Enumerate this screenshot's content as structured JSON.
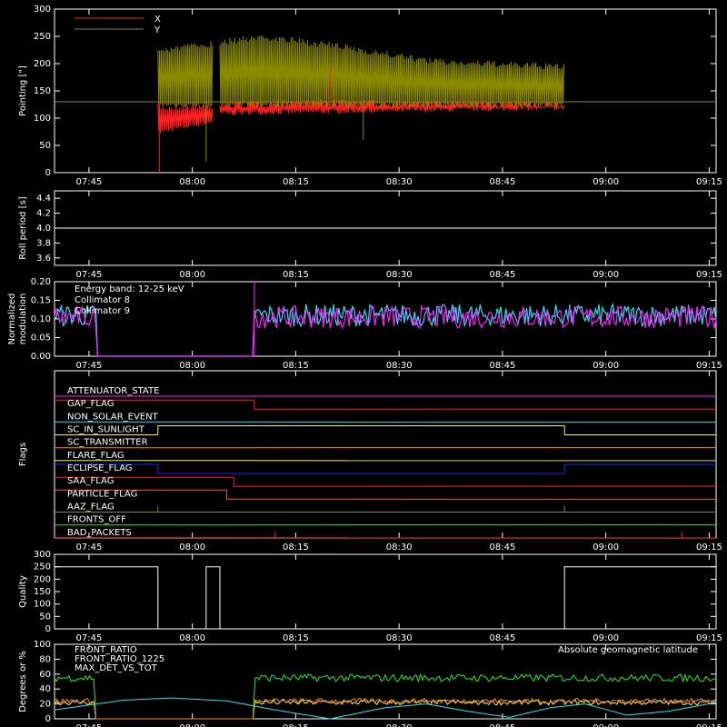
{
  "x_ticks": [
    "07:45",
    "08:00",
    "08:15",
    "08:30",
    "08:45",
    "09:00",
    "09:15"
  ],
  "colors": {
    "axes": "#ffffff",
    "red": "#ff2020",
    "olive": "#8a8a00",
    "cyan": "#22e6ee",
    "magenta": "#ff20ff",
    "green": "#22ee22",
    "orange": "#ff8a1a",
    "yellow": "#f5f54a",
    "blue": "#2222ff",
    "brown": "#c86414",
    "darkorange": "#ff5a00"
  },
  "chart_data": [
    {
      "id": "pointing",
      "type": "line",
      "ylabel": "Pointing [\"]",
      "ylim": [
        0,
        300
      ],
      "yticks": [
        "0",
        "50",
        "100",
        "150",
        "200",
        "250",
        "300"
      ],
      "legend": [
        "X",
        "Y"
      ],
      "baseline": 130,
      "segments": [
        [
          "07:55",
          "08:03"
        ],
        [
          "08:04",
          "08:54"
        ]
      ],
      "series": [
        {
          "name": "X",
          "color": "#ff2020",
          "low": [
            [
              "07:55",
              70
            ],
            [
              "08:03",
              90
            ],
            [
              "08:04",
              105
            ],
            [
              "08:30",
              110
            ],
            [
              "08:54",
              115
            ]
          ],
          "high": [
            [
              "07:55",
              125
            ],
            [
              "08:15",
              135
            ],
            [
              "08:54",
              130
            ]
          ]
        },
        {
          "name": "Y",
          "color": "#8a8a00",
          "low": [
            [
              "07:55",
              120
            ],
            [
              "08:54",
              120
            ]
          ],
          "high": [
            [
              "07:55",
              230
            ],
            [
              "08:04",
              245
            ],
            [
              "08:10",
              255
            ],
            [
              "08:20",
              240
            ],
            [
              "08:35",
              210
            ],
            [
              "08:54",
              200
            ]
          ]
        }
      ]
    },
    {
      "id": "roll",
      "type": "line",
      "ylabel": "Roll period [s]",
      "ylim": [
        3.5,
        4.5
      ],
      "yticks": [
        "3.6",
        "3.8",
        "4.0",
        "4.2",
        "4.4"
      ],
      "series": [
        {
          "name": "",
          "values": [
            [
              "07:40",
              4.0
            ],
            [
              "09:16",
              4.0
            ]
          ]
        }
      ]
    },
    {
      "id": "modulation",
      "type": "line",
      "ylabel": [
        "Normalized",
        "modulation"
      ],
      "ylim": [
        0,
        0.2
      ],
      "yticks": [
        "0.00",
        "0.05",
        "0.10",
        "0.15",
        "0.20"
      ],
      "annotation": "Energy band: 12-25 keV",
      "legend": [
        "Collimator 8",
        "Collimator 9"
      ],
      "gap": [
        "07:46",
        "08:09"
      ],
      "series": [
        {
          "name": "Collimator 8",
          "color": "#22e6ee",
          "mean": 0.11
        },
        {
          "name": "Collimator 9",
          "color": "#ff20ff",
          "mean": 0.105
        }
      ]
    },
    {
      "id": "flags",
      "type": "line",
      "ylabel": "Flags",
      "flags": [
        {
          "label": "ATTENUATOR_STATE",
          "color": "#ff20ff",
          "steps": [
            [
              "07:40",
              0
            ],
            [
              "09:16",
              0
            ]
          ]
        },
        {
          "label": "GAP_FLAG",
          "color": "#ff2020",
          "steps": [
            [
              "07:40",
              1
            ],
            [
              "08:09",
              0
            ]
          ]
        },
        {
          "label": "NON_SOLAR_EVENT",
          "color": "#22e6ee",
          "steps": [
            [
              "07:40",
              0
            ]
          ]
        },
        {
          "label": "SC_IN_SUNLIGHT",
          "color": "#f5f54a",
          "steps": [
            [
              "07:40",
              0
            ],
            [
              "07:55",
              1
            ],
            [
              "08:54",
              0
            ]
          ]
        },
        {
          "label": "SC_TRANSMITTER",
          "color": "#ff8a1a",
          "steps": [
            [
              "07:40",
              0
            ]
          ]
        },
        {
          "label": "FLARE_FLAG",
          "color": "#f5f54a",
          "steps": [
            [
              "07:40",
              0
            ]
          ]
        },
        {
          "label": "ECLIPSE_FLAG",
          "color": "#2222ff",
          "steps": [
            [
              "07:40",
              1
            ],
            [
              "07:55",
              0
            ],
            [
              "08:54",
              1
            ]
          ]
        },
        {
          "label": "SAA_FLAG",
          "color": "#ff2020",
          "steps": [
            [
              "07:40",
              1
            ],
            [
              "08:06",
              0
            ]
          ]
        },
        {
          "label": "PARTICLE_FLAG",
          "color": "#ff5a00",
          "steps": [
            [
              "07:40",
              1
            ],
            [
              "08:05",
              0
            ]
          ]
        },
        {
          "label": "AAZ_FLAG",
          "color": "#8a8a00",
          "steps": [
            [
              "07:40",
              0
            ]
          ],
          "spikes": [
            "07:55",
            "08:54"
          ]
        },
        {
          "label": "FRONTS_OFF",
          "color": "#22ee22",
          "steps": [
            [
              "07:40",
              0
            ]
          ]
        },
        {
          "label": "BAD_PACKETS",
          "color": "#ff2020",
          "steps": [
            [
              "07:40",
              0
            ]
          ],
          "spikes": [
            "08:12",
            "09:11"
          ]
        }
      ]
    },
    {
      "id": "quality",
      "type": "line",
      "ylabel": "Quality",
      "ylim": [
        0,
        300
      ],
      "yticks": [
        "0",
        "50",
        "100",
        "150",
        "200",
        "250",
        "300"
      ],
      "series": [
        {
          "name": "",
          "values": [
            [
              "07:40",
              250
            ],
            [
              "07:55",
              250
            ],
            [
              "07:55",
              0
            ],
            [
              "08:02",
              0
            ],
            [
              "08:02",
              250
            ],
            [
              "08:04",
              250
            ],
            [
              "08:04",
              0
            ],
            [
              "08:54",
              0
            ],
            [
              "08:54",
              250
            ],
            [
              "09:16",
              250
            ]
          ]
        }
      ]
    },
    {
      "id": "ratios",
      "type": "line",
      "ylabel": "Degrees or %",
      "ylim": [
        0,
        100
      ],
      "yticks": [
        "0",
        "20",
        "40",
        "60",
        "80",
        "100"
      ],
      "legend": [
        "FRONT_RATIO",
        "FRONT_RATIO_1225",
        "MAX_DET_VS_TOT"
      ],
      "annotation": "Absolute geomagnetic latitude",
      "gap": [
        "07:46",
        "08:09"
      ],
      "series": [
        {
          "name": "FRONT_RATIO",
          "color": "#f5f54a",
          "mean": 22
        },
        {
          "name": "FRONT_RATIO_1225",
          "color": "#22ee22",
          "mean": 55
        },
        {
          "name": "MAX_DET_VS_TOT",
          "color": "#ff8a1a",
          "mean": 24
        },
        {
          "name": "Absolute geomagnetic latitude",
          "color": "#22e6ee",
          "values": [
            [
              "07:40",
              12
            ],
            [
              "07:50",
              25
            ],
            [
              "07:57",
              28
            ],
            [
              "08:05",
              24
            ],
            [
              "08:12",
              12
            ],
            [
              "08:20",
              0
            ],
            [
              "08:28",
              15
            ],
            [
              "08:34",
              20
            ],
            [
              "08:40",
              10
            ],
            [
              "08:46",
              2
            ],
            [
              "08:52",
              15
            ],
            [
              "08:57",
              20
            ],
            [
              "09:03",
              5
            ],
            [
              "09:09",
              10
            ],
            [
              "09:16",
              22
            ]
          ]
        }
      ]
    }
  ]
}
